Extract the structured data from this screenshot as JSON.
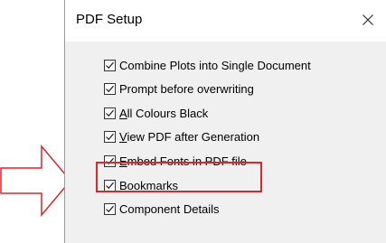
{
  "dialog": {
    "title": "PDF Setup",
    "close_icon": "close-icon"
  },
  "options": [
    {
      "label": "Combine Plots into Single Document",
      "mnemonic": "",
      "checked": true
    },
    {
      "label": "Prompt before overwriting",
      "mnemonic": "",
      "checked": true
    },
    {
      "label": "All Colours Black",
      "mnemonic": "A",
      "checked": true
    },
    {
      "label": "View PDF after Generation",
      "mnemonic": "V",
      "checked": true
    },
    {
      "label": "Embed Fonts in PDF file",
      "mnemonic": "E",
      "checked": true,
      "highlighted": true
    },
    {
      "label": "Bookmarks",
      "mnemonic": "",
      "checked": true
    },
    {
      "label": "Component Details",
      "mnemonic": "",
      "checked": true
    }
  ],
  "annotation": {
    "arrow_icon": "right-arrow-icon",
    "arrow_color": "#e0242b",
    "highlight_color": "#e0242b"
  }
}
